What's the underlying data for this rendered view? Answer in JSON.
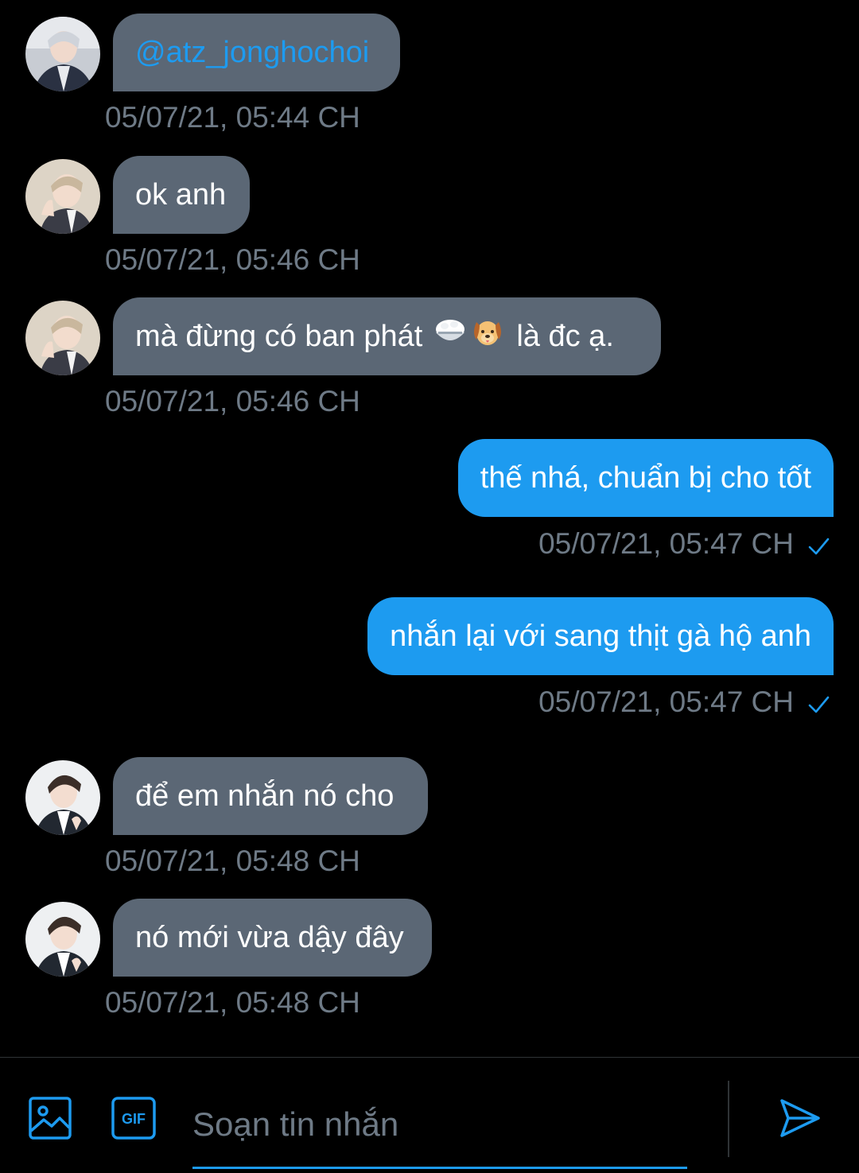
{
  "colors": {
    "background": "#000000",
    "incoming_bubble": "#5b6775",
    "outgoing_bubble": "#1d9bf0",
    "timestamp": "#6e7a86",
    "accent": "#1d9bf0"
  },
  "messages": [
    {
      "direction": "in",
      "text": "@atz_jonghochoi",
      "time": "05/07/21, 05:44 CH",
      "avatar": "avatar-icon"
    },
    {
      "direction": "in",
      "text": "ok anh",
      "time": "05/07/21, 05:46 CH",
      "avatar": "avatar-icon"
    },
    {
      "direction": "in",
      "text_before": "mà đừng có ban phát",
      "emoji": [
        "rice-bowl-icon",
        "dog-face-icon"
      ],
      "text_after": "là đc ạ.",
      "time": "05/07/21, 05:46 CH",
      "avatar": "avatar-icon"
    },
    {
      "direction": "out",
      "text": "thế nhá, chuẩn bị cho tốt",
      "time": "05/07/21, 05:47 CH",
      "status": "sent-check-icon"
    },
    {
      "direction": "out",
      "text": "nhắn lại với sang thịt gà hộ anh",
      "time": "05/07/21, 05:47 CH",
      "status": "sent-check-icon"
    },
    {
      "direction": "in",
      "text": "để em nhắn nó cho",
      "time": "05/07/21, 05:48 CH",
      "avatar": "avatar-icon"
    },
    {
      "direction": "in",
      "text": "nó mới vừa dậy đây",
      "time": "05/07/21, 05:48 CH",
      "avatar": "avatar-icon"
    }
  ],
  "composer": {
    "placeholder": "Soạn tin nhắn",
    "value": "",
    "icons": [
      "image-icon",
      "gif-icon",
      "send-icon"
    ]
  }
}
